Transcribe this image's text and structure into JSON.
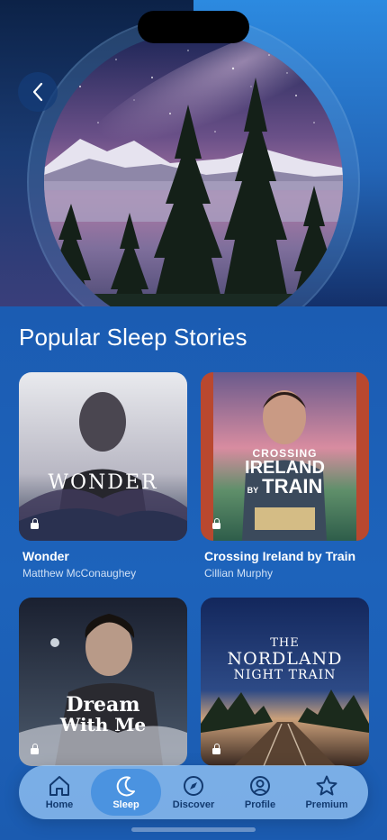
{
  "hero": {
    "image": "night-forest-milky-way-illustration",
    "back_icon": "chevron-left-icon"
  },
  "section": {
    "title": "Popular Sleep Stories"
  },
  "stories": [
    {
      "title": "Wonder",
      "narrator": "Matthew McConaughey",
      "art_text": "WONDER",
      "locked": true
    },
    {
      "title": "Crossing Ireland by Train",
      "narrator": "Cillian Murphy",
      "art_lines": [
        "CROSSING",
        "IRELAND",
        "BY",
        "TRAIN"
      ],
      "locked": true
    },
    {
      "title": "",
      "narrator": "",
      "art_lines": [
        "Dream",
        "With Me"
      ],
      "locked": true
    },
    {
      "title": "",
      "narrator": "",
      "art_lines": [
        "THE",
        "NORDLAND",
        "NIGHT TRAIN"
      ],
      "locked": true
    }
  ],
  "nav": {
    "items": [
      {
        "label": "Home",
        "icon": "home-icon",
        "active": false
      },
      {
        "label": "Sleep",
        "icon": "moon-icon",
        "active": true
      },
      {
        "label": "Discover",
        "icon": "compass-icon",
        "active": false
      },
      {
        "label": "Profile",
        "icon": "profile-icon",
        "active": false
      },
      {
        "label": "Premium",
        "icon": "star-icon",
        "active": false
      }
    ]
  },
  "colors": {
    "background": "#1b5fb4",
    "nav_bar": "#a0cdfa",
    "nav_active": "#4b93e0",
    "nav_label": "#123a70",
    "subtitle": "#cfe0f5"
  }
}
